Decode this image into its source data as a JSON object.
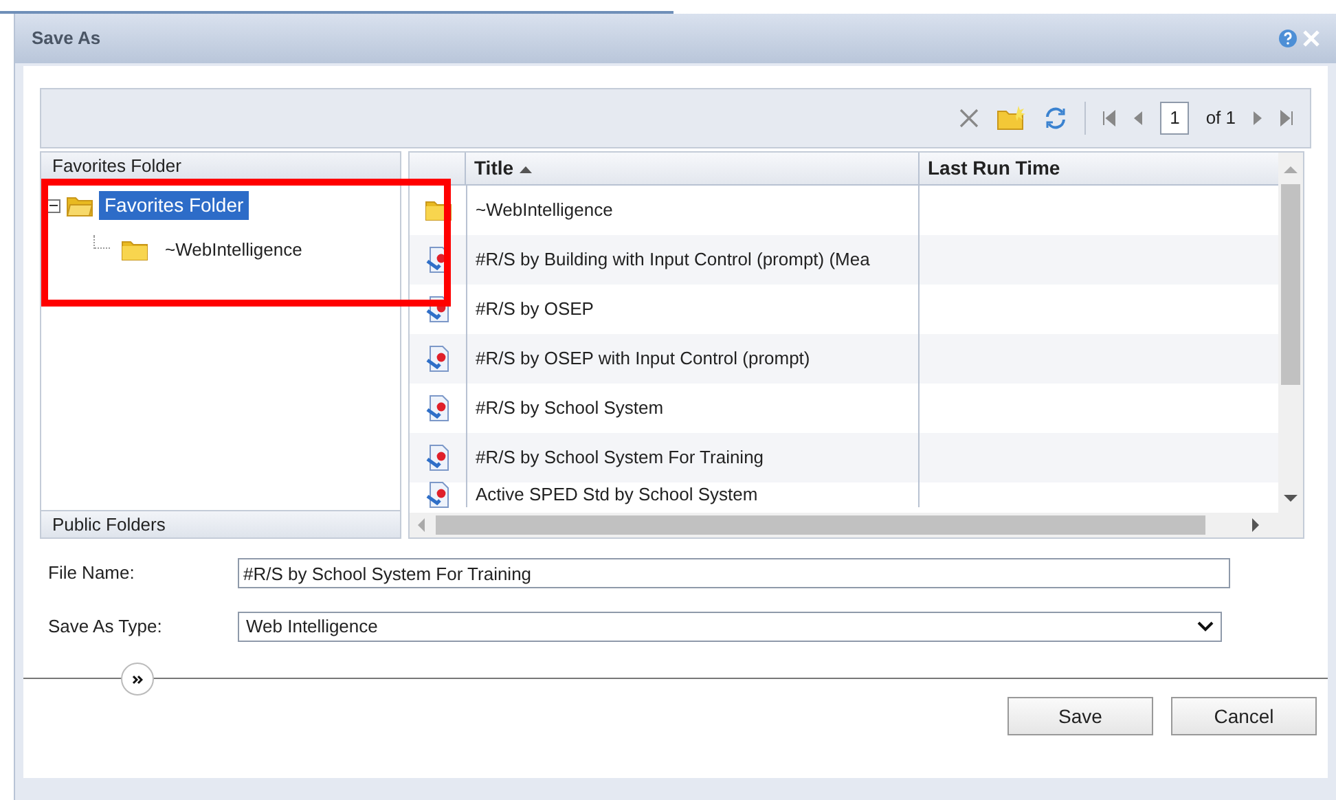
{
  "window": {
    "title": "Save As"
  },
  "toolbar": {
    "page_input": "1",
    "page_count": "of 1"
  },
  "tree": {
    "header": "Favorites Folder",
    "items": [
      {
        "label": "Favorites Folder",
        "selected": true,
        "expanded": true,
        "children": [
          {
            "label": "~WebIntelligence",
            "selected": false
          }
        ]
      }
    ],
    "footer": "Public Folders"
  },
  "table": {
    "columns": [
      {
        "label": "Title",
        "sorted": true
      },
      {
        "label": "Last Run Time",
        "sorted": false
      }
    ],
    "rows": [
      {
        "kind": "folder",
        "title": "~WebIntelligence"
      },
      {
        "kind": "report",
        "title": "#R/S by Building with Input Control (prompt) (Mea"
      },
      {
        "kind": "report",
        "title": "#R/S by OSEP"
      },
      {
        "kind": "report",
        "title": "#R/S by OSEP with Input Control (prompt)"
      },
      {
        "kind": "report",
        "title": "#R/S by School System"
      },
      {
        "kind": "report",
        "title": "#R/S by School System For Training"
      },
      {
        "kind": "report",
        "title": "Active SPED Std by School System"
      }
    ]
  },
  "form": {
    "file_name_label": "File Name:",
    "file_name": "#R/S by School System For Training",
    "type_label": "Save As Type:",
    "type_value": "Web Intelligence"
  },
  "buttons": [
    "Save",
    "Cancel"
  ]
}
